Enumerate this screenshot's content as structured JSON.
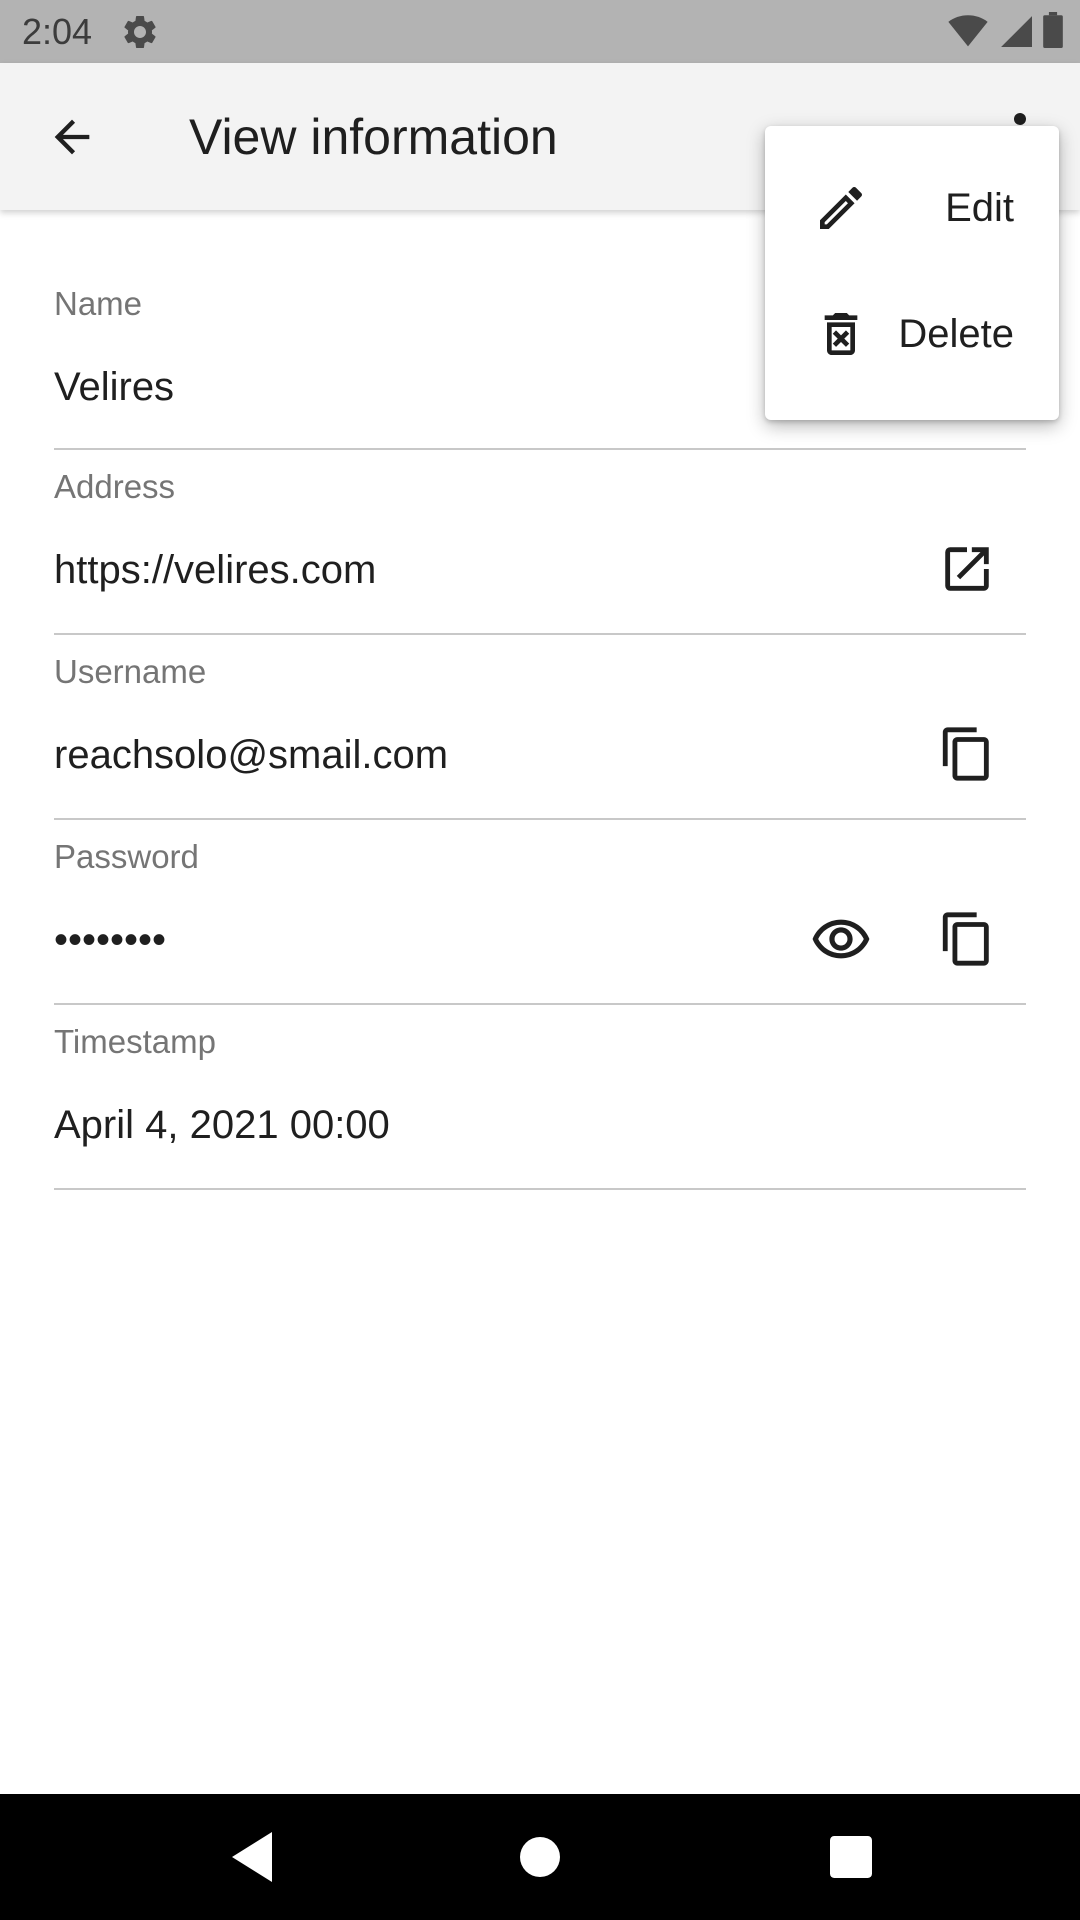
{
  "status_bar": {
    "time": "2:04",
    "icons": [
      "gear-icon",
      "wifi-icon",
      "signal-icon",
      "battery-icon"
    ]
  },
  "app_bar": {
    "title": "View information",
    "back_icon": "arrow-back-icon",
    "overflow_icon": "more-vert-icon"
  },
  "fields": {
    "name": {
      "label": "Name",
      "value": "Velires"
    },
    "address": {
      "label": "Address",
      "value": "https://velires.com"
    },
    "username": {
      "label": "Username",
      "value": "reachsolo@smail.com"
    },
    "password": {
      "label": "Password",
      "value": "••••••••"
    },
    "timestamp": {
      "label": "Timestamp",
      "value": "April 4, 2021 00:00"
    }
  },
  "menu": {
    "items": [
      {
        "label": "Edit",
        "icon": "pencil-icon"
      },
      {
        "label": "Delete",
        "icon": "delete-icon"
      }
    ]
  },
  "nav_bar": {
    "icons": [
      "back-triangle-icon",
      "home-circle-icon",
      "recents-square-icon"
    ]
  },
  "colors": {
    "status_bar": "#b3b3b3",
    "app_bar": "#f3f3f3",
    "divider": "#c8c8c8",
    "label": "#757575",
    "text": "#1f1f1f",
    "nav_bar": "#000000"
  }
}
